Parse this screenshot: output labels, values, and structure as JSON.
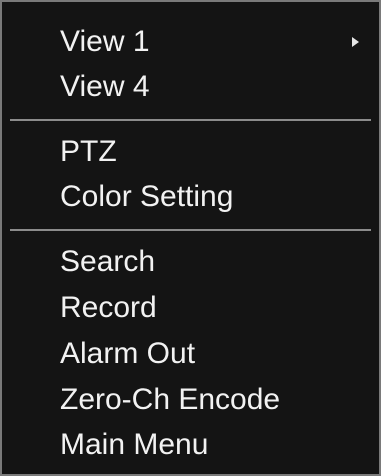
{
  "menu": {
    "items": [
      {
        "label": "View 1",
        "submenu_indicator": "triangle-right-icon"
      },
      {
        "label": "View 4"
      },
      {
        "label": "PTZ"
      },
      {
        "label": "Color Setting"
      },
      {
        "label": "Search"
      },
      {
        "label": "Record"
      },
      {
        "label": "Alarm Out"
      },
      {
        "label": "Zero-Ch Encode"
      },
      {
        "label": "Main Menu"
      }
    ],
    "colors": {
      "background": "#141414",
      "text": "#f2f2f2",
      "border": "#7a7a7a",
      "divider": "#8c8c8c"
    }
  }
}
